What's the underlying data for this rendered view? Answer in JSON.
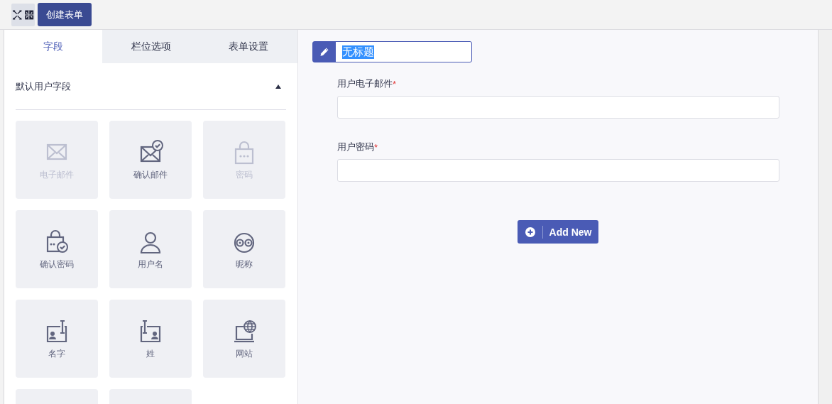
{
  "toolbar": {
    "create_button": "创建表单"
  },
  "tabs": [
    {
      "label": "字段",
      "selected": true
    },
    {
      "label": "栏位选项",
      "selected": false
    },
    {
      "label": "表单设置",
      "selected": false
    }
  ],
  "section": {
    "title": "默认用户字段",
    "expanded": true
  },
  "fields": [
    {
      "kind": "email",
      "label": "电子邮件",
      "disabled": true
    },
    {
      "kind": "confirm-email",
      "label": "确认邮件",
      "disabled": false
    },
    {
      "kind": "password",
      "label": "密码",
      "disabled": true
    },
    {
      "kind": "confirm-password",
      "label": "确认密码",
      "disabled": false
    },
    {
      "kind": "username",
      "label": "用户名",
      "disabled": false
    },
    {
      "kind": "nickname",
      "label": "昵称",
      "disabled": false
    },
    {
      "kind": "first-name",
      "label": "名字",
      "disabled": false
    },
    {
      "kind": "last-name",
      "label": "姓",
      "disabled": false
    },
    {
      "kind": "website",
      "label": "网站",
      "disabled": false
    },
    {
      "kind": "cut-off"
    },
    {
      "kind": "cut-off"
    }
  ],
  "form": {
    "title": {
      "value": "无标题",
      "text_selected": true
    },
    "rows": [
      {
        "label": "用户电子邮件",
        "required_mark": "*"
      },
      {
        "label": "用户密码",
        "required_mark": "*"
      }
    ],
    "add_button": "Add New"
  }
}
